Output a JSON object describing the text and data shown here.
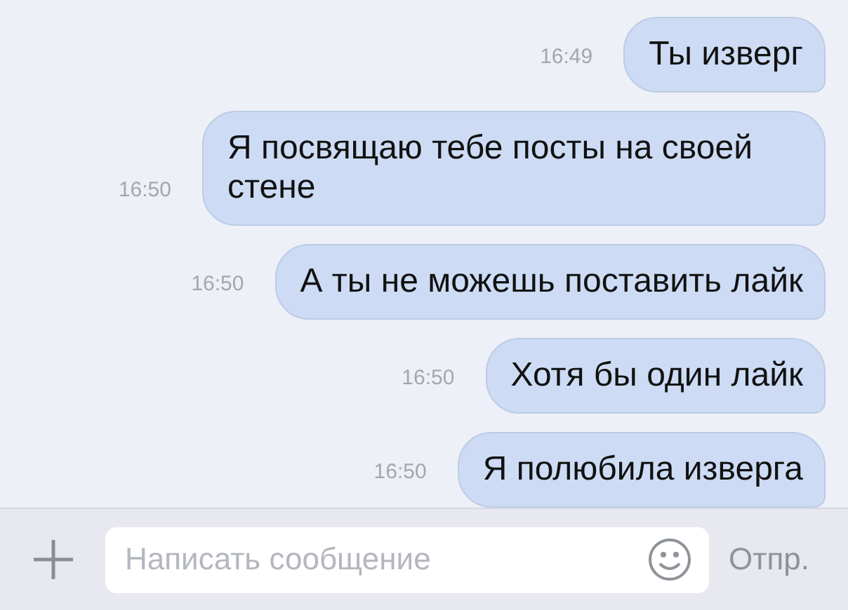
{
  "messages": [
    {
      "time": "16:49",
      "text": "Ты изверг"
    },
    {
      "time": "16:50",
      "text": "Я посвящаю тебе посты на своей стене"
    },
    {
      "time": "16:50",
      "text": "А ты не можешь поставить лайк"
    },
    {
      "time": "16:50",
      "text": "Хотя бы один лайк"
    },
    {
      "time": "16:50",
      "text": "Я полюбила изверга"
    }
  ],
  "composer": {
    "placeholder": "Написать сообщение",
    "send_label": "Отпр."
  }
}
